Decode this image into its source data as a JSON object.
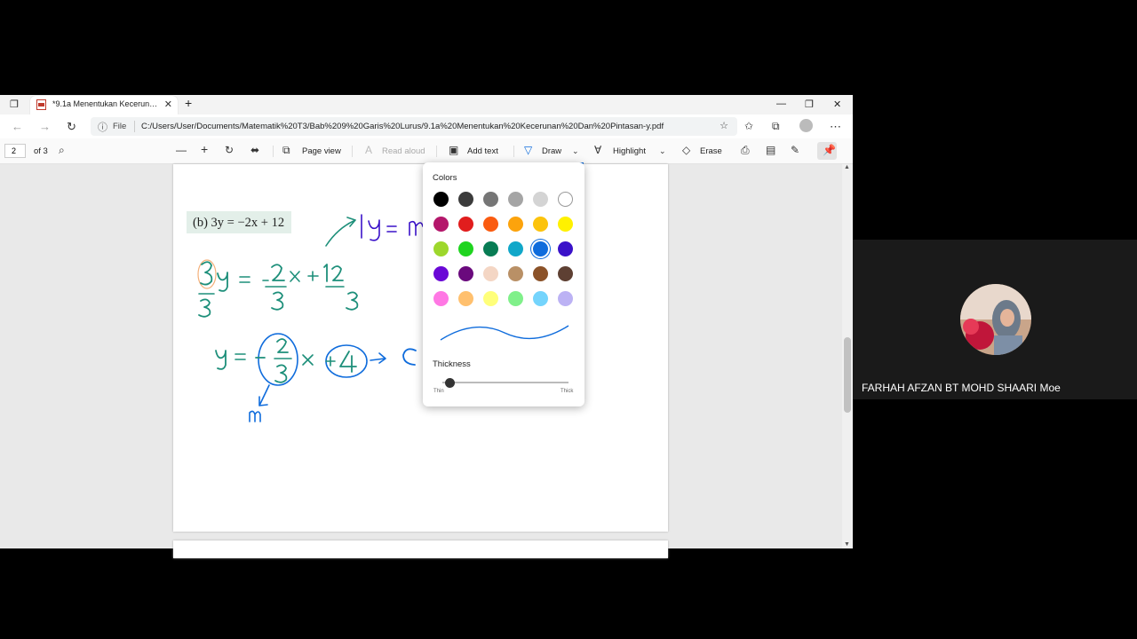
{
  "tab": {
    "title": "*9.1a Menentukan Kecerunan Dan Pintasan-y.pdf"
  },
  "address": {
    "file_label": "File",
    "url": "C:/Users/User/Documents/Matematik%20T3/Bab%209%20Garis%20Lurus/9.1a%20Menentukan%20Kecerunan%20Dan%20Pintasan-y.pdf"
  },
  "toolbar": {
    "page_number": "2",
    "page_total": "of 3",
    "page_view": "Page view",
    "read_aloud": "Read aloud",
    "add_text": "Add text",
    "draw": "Draw",
    "highlight": "Highlight",
    "erase": "Erase"
  },
  "document": {
    "equation": "(b)  3y = −2x + 12"
  },
  "draw_panel": {
    "colors_label": "Colors",
    "thickness_label": "Thickness",
    "thin_label": "Thin",
    "thick_label": "Thick",
    "thickness_value": 0.05,
    "selected_color": "#0f6cdc",
    "colors": [
      "#000000",
      "#3b3b3b",
      "#767676",
      "#a5a5a5",
      "#d4d4d4",
      "#ffffff",
      "#b4176b",
      "#e11d1d",
      "#fa5b10",
      "#fca30c",
      "#fcc30c",
      "#fff100",
      "#9dd72c",
      "#1fd41f",
      "#087c54",
      "#11a7c9",
      "#0f6cdc",
      "#3a12c9",
      "#6a08d6",
      "#6a0a7d",
      "#f4d6c4",
      "#b99066",
      "#8b5229",
      "#5e4033",
      "#ff78e4",
      "#ffc06e",
      "#ffff7a",
      "#80f08a",
      "#74d4fc",
      "#bcb2f4"
    ]
  },
  "video": {
    "participant_name": "FARHAH AFZAN BT MOHD SHAARI Moe"
  }
}
